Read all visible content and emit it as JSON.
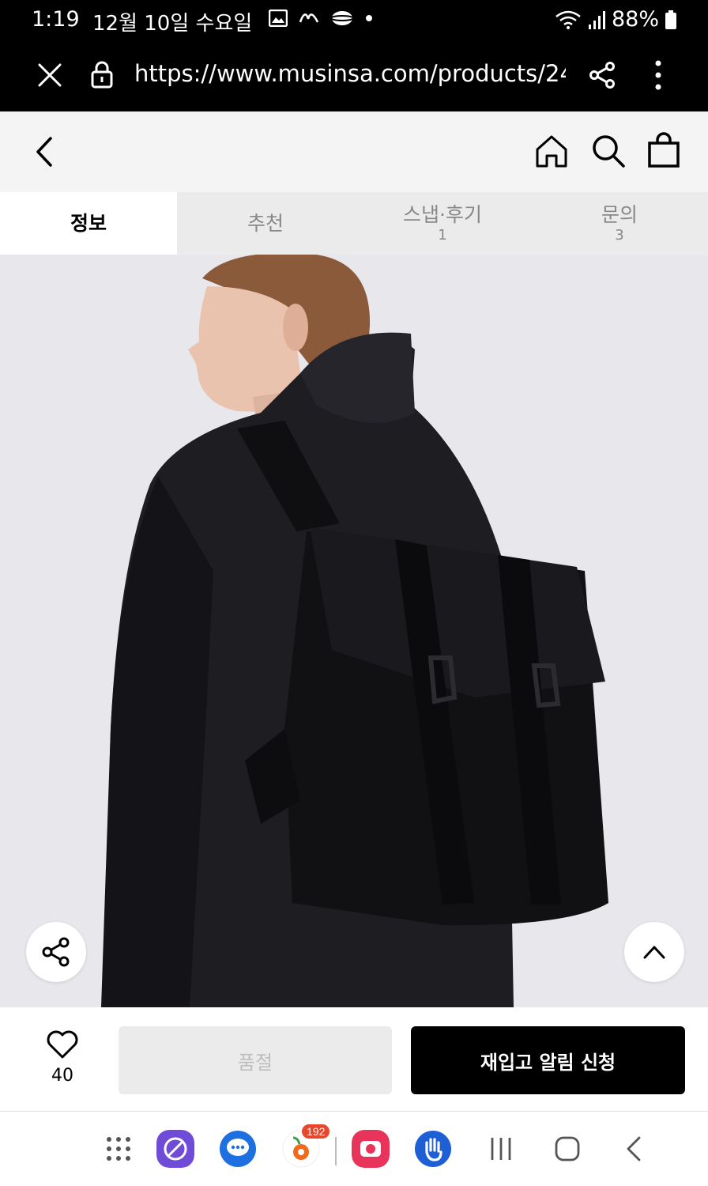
{
  "status_bar": {
    "time": "1:19",
    "date": "12월 10일 수요일",
    "battery": "88%"
  },
  "browser": {
    "url": "https://www.musinsa.com/products/24"
  },
  "tabs": [
    {
      "label": "정보",
      "count": ""
    },
    {
      "label": "추천",
      "count": ""
    },
    {
      "label": "스냅·후기",
      "count": "1"
    },
    {
      "label": "문의",
      "count": "3"
    }
  ],
  "purchase_bar": {
    "like_count": "40",
    "soldout_label": "품절",
    "restock_label": "재입고 알림 신청"
  },
  "nav_bar": {
    "badge_count": "192"
  },
  "colors": {
    "accent": "#000000",
    "disabled_bg": "#ebebeb",
    "image_bg": "#e8e8ec"
  }
}
